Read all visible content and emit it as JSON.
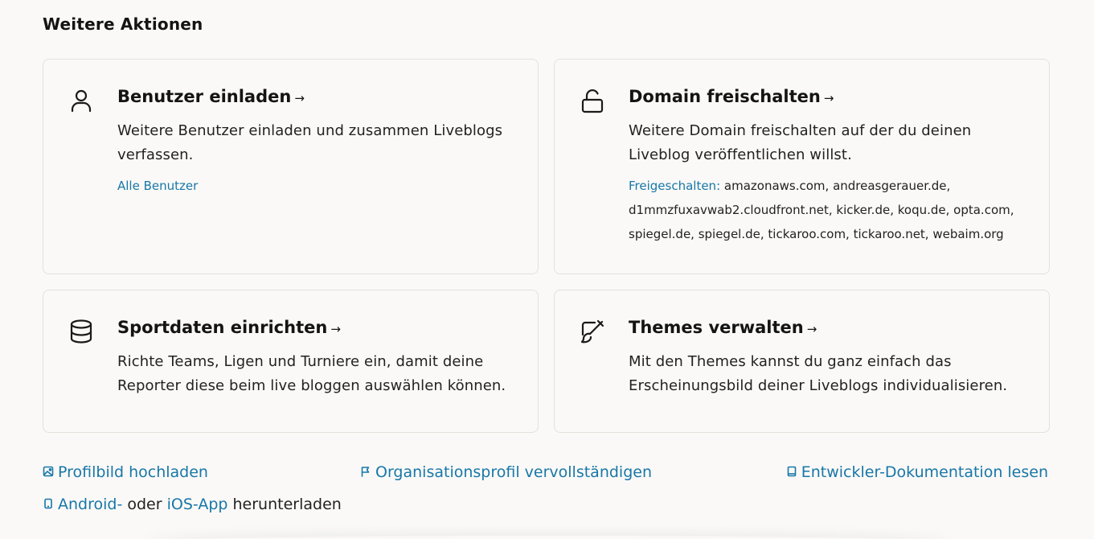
{
  "section": {
    "title": "Weitere Aktionen"
  },
  "cards": [
    {
      "icon": "user-icon",
      "title": "Benutzer einladen",
      "arrow": "→",
      "description": "Weitere Benutzer einladen und zusammen Liveblogs verfassen.",
      "link": "Alle Benutzer"
    },
    {
      "icon": "unlock-icon",
      "title": "Domain freischalten",
      "arrow": "→",
      "description": "Weitere Domain freischalten auf der du deinen Liveblog veröffentlichen willst.",
      "meta_label": "Freigeschalten:",
      "meta_value": "amazonaws.com, andreasgerauer.de, d1mmzfuxavwab2.cloudfront.net, kicker.de, koqu.de, opta.com, spiegel.de, spiegel.de, tickaroo.com, tickaroo.net, webaim.org"
    },
    {
      "icon": "database-icon",
      "title": "Sportdaten einrichten",
      "arrow": "→",
      "description": "Richte Teams, Ligen und Turniere ein, damit deine Reporter diese beim live bloggen auswählen können."
    },
    {
      "icon": "paint-brush-icon",
      "title": "Themes verwalten",
      "arrow": "→",
      "description": "Mit den Themes kannst du ganz einfach das Erscheinungsbild deiner Liveblogs individualisieren."
    }
  ],
  "links": {
    "profile_picture": "Profilbild hochladen",
    "organisation_profile": "Organisationsprofil vervollständigen",
    "developer_docs": "Entwickler-Dokumentation lesen",
    "android": "Android-",
    "or": "oder",
    "ios": "iOS-App",
    "download": "herunterladen"
  },
  "colors": {
    "link": "#1877a8",
    "background": "#faf9f7",
    "border": "#e4e1dc"
  }
}
